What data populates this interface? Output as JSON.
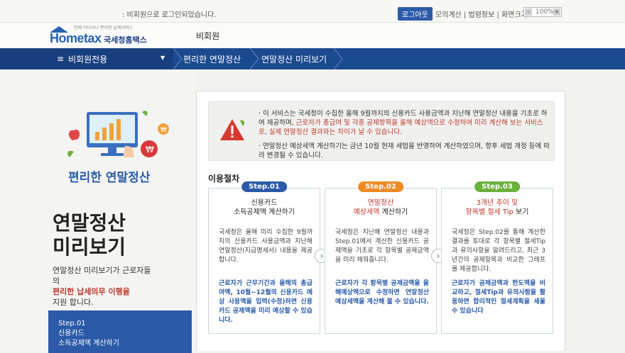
{
  "topbar": {
    "message": ": 비회원으로 로그인되었습니다.",
    "logout_label": "로그아웃",
    "links": "모의계산 | 법령정보 | 화면크기",
    "zoom": "100%"
  },
  "header": {
    "brand": "Hometax",
    "brand_kr": "국세청홈택스",
    "tagline": "언제 어디서나 편리한 납세서비스",
    "member_label": "비회원"
  },
  "nav": {
    "menu_label": "비회원전용",
    "crumb1": "편리한 연말정산",
    "crumb2": "연말정산 미리보기"
  },
  "left": {
    "panel_title": "편리한 연말정산",
    "big_title_1": "연말정산",
    "big_title_2": "미리보기",
    "desc_1": "연말정산 미리보기가 근로자들의",
    "desc_hl": "편리한 납세의무 이행을",
    "desc_2": "지원 합니다.",
    "step_label": "Step.01",
    "step_line1": "신용카드",
    "step_line2": "소득공제액 계산하기"
  },
  "notice": {
    "p1_a": "· 이 서비스는 국세청이 수집한 올해 9월까지의 신용카드 사용금액과 지난해 연말정산 내용을 기초로 하여 제공하며, ",
    "p1_red": "근로자가 총급여 및 각종 공제항목을 올해 예상액으로 수정하여 미리 계산해 보는 서비스로, 실제 연말정산 결과와는 차이가 날 수 있습니다.",
    "p2": "· 연말정산 예상세액 계산하기는 금년 10월 현재 세법을 반영하여 계산하였으며, 향후 세법 개정 등에 따라 변경될 수 있습니다."
  },
  "section_title": "이용절차",
  "steps": [
    {
      "badge": "Step.01",
      "color": "#2b5aa8",
      "title_hl": "",
      "title_1": "신용카드",
      "title_2": "소득공제액 계산하기",
      "body": "국세청은 올해 미리 수집한 9월까지의 신용카드 사용금액과 지난해 연말정산(지급명세서) 내용을 제공합니다.",
      "body2": "근로자가 근무기간과 올해의 총급여액, 10월~12월의 신용카드 예상 사용액을 입력(수정)하면 신용카드 공제액을 미리 예상할 수 있습니다."
    },
    {
      "badge": "Step.02",
      "color": "#f08a24",
      "title_hl": "연말정산",
      "title_1": "예상세액",
      "title_2": " 계산하기",
      "body": "국세청은 지난해 연말정산 내용과 Step.01에서 계산한 신용카드 공제액을 기초로 각 항목별 공제금액을 미리 채워줍니다.",
      "body2": "근로자가 각 항목별 공제금액을 올해예상액으로 수정하면 연말정산 예상세액을 계산해 볼 수 있습니다."
    },
    {
      "badge": "Step.03",
      "color": "#6bb13a",
      "title_hl": "3개년 추이 및",
      "title_1": "항목별 절세 Tip",
      "title_2": " 보기",
      "body": "국세청은 Step.02를 통해 계산한 결과를 토대로 각 항목별 절세Tip과 유의사항을 알려드리고, 최근 3년간의 공제항목과 비교한 그래프를 제공합니다.",
      "body2": "근로자가 공제금액과 한도액을 비교하고, 절세Tip과 유의사항을 활용하면 합리적인 절세계획을 세울 수 있습니다"
    }
  ]
}
